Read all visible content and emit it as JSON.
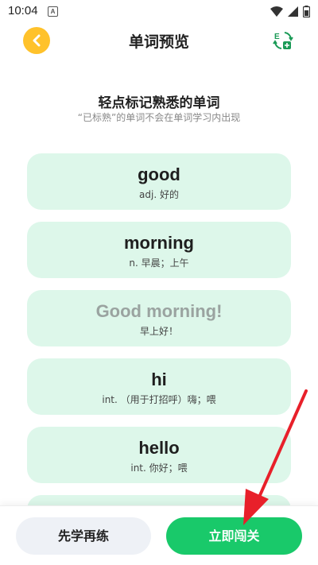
{
  "status_bar": {
    "time": "10:04",
    "notification_glyph": "A",
    "icons": [
      "wifi-icon",
      "cell-signal-icon",
      "battery-icon"
    ]
  },
  "header": {
    "title": "单词预览",
    "back_icon": "chevron-left-icon",
    "switch_icon": "swap-language-icon"
  },
  "intro": {
    "heading": "轻点标记熟悉的单词",
    "subheading": "“已标熟”的单词不会在单词学习内出现"
  },
  "words": [
    {
      "word": "good",
      "meaning": "adj. 好的",
      "known": false
    },
    {
      "word": "morning",
      "meaning": "n. 早晨；上午",
      "known": false
    },
    {
      "word": "Good morning!",
      "meaning": "早上好！",
      "known": true
    },
    {
      "word": "hi",
      "meaning": "int. （用于打招呼）嗨；喂",
      "known": false
    },
    {
      "word": "hello",
      "meaning": "int. 你好；喂",
      "known": false
    }
  ],
  "actions": {
    "study_first": "先学再练",
    "start_challenge": "立即闯关"
  },
  "colors": {
    "accent_green": "#19c96a",
    "card_bg": "#ddf7ea",
    "back_button": "#ffc22b",
    "annotation_arrow": "#e8202a"
  }
}
